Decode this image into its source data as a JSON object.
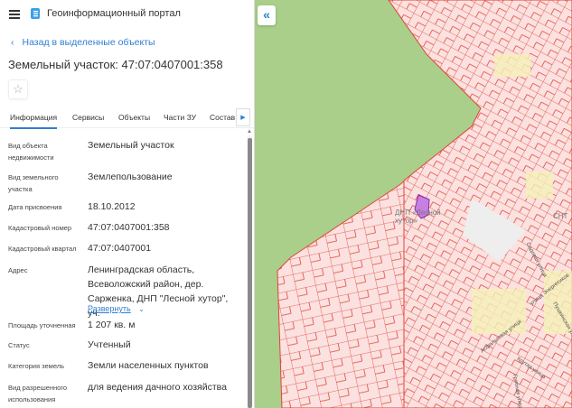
{
  "header": {
    "app_title": "Геоинформационный портал"
  },
  "back_link": "Назад в выделенные объекты",
  "page_title": "Земельный участок: 47:07:0407001:358",
  "tabs": [
    "Информация",
    "Сервисы",
    "Объекты",
    "Части ЗУ",
    "Состав"
  ],
  "fields": [
    {
      "label": "Вид объекта недвижимости",
      "value": "Земельный участок"
    },
    {
      "label": "Вид земельного участка",
      "value": "Землепользование"
    },
    {
      "label": "Дата присвоения",
      "value": "18.10.2012"
    },
    {
      "label": "Кадастровый номер",
      "value": "47:07:0407001:358"
    },
    {
      "label": "Кадастровый квартал",
      "value": "47:07:0407001"
    },
    {
      "label": "Адрес",
      "value": "Ленинградская область, Всеволожский район, дер. Сарженка, ДНП \"Лесной хутор\", уч."
    },
    {
      "label": "Площадь уточненная",
      "value": "1 207 кв. м"
    },
    {
      "label": "Статус",
      "value": "Учтенный"
    },
    {
      "label": "Категория земель",
      "value": "Земли населенных пунктов"
    },
    {
      "label": "Вид разрешенного использования",
      "value": "для ведения дачного хозяйства"
    }
  ],
  "expand_label": "Развернуть",
  "map": {
    "labels": {
      "dnp": "ДНП «Лесной хутор»",
      "snt": "СНТ"
    },
    "streets": [
      "Садовая улица",
      "улица Энергетиков",
      "Асфальтовая улица",
      "Крутая улица",
      "Грибная улица",
      "Пушкинская улица"
    ],
    "colors": {
      "forest": "#a9cf8a",
      "parcel_fill": "#fbe1df",
      "parcel_line": "#e0453a",
      "selected": "#c77fe0"
    }
  }
}
